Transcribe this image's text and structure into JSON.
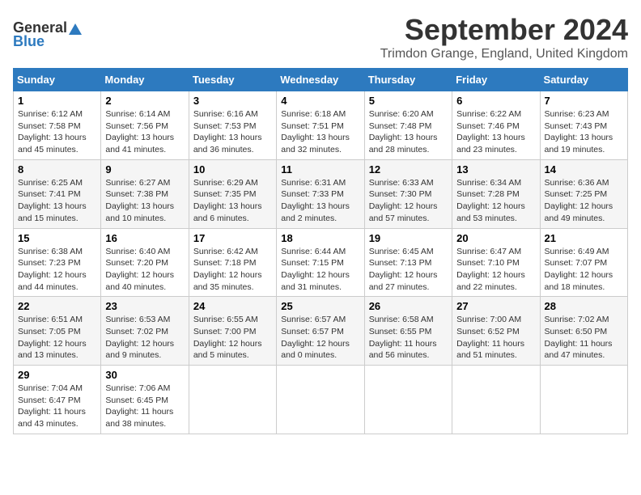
{
  "header": {
    "logo_general": "General",
    "logo_blue": "Blue",
    "month_title": "September 2024",
    "location": "Trimdon Grange, England, United Kingdom"
  },
  "weekdays": [
    "Sunday",
    "Monday",
    "Tuesday",
    "Wednesday",
    "Thursday",
    "Friday",
    "Saturday"
  ],
  "weeks": [
    [
      {
        "day": "1",
        "sunrise": "Sunrise: 6:12 AM",
        "sunset": "Sunset: 7:58 PM",
        "daylight": "Daylight: 13 hours and 45 minutes."
      },
      {
        "day": "2",
        "sunrise": "Sunrise: 6:14 AM",
        "sunset": "Sunset: 7:56 PM",
        "daylight": "Daylight: 13 hours and 41 minutes."
      },
      {
        "day": "3",
        "sunrise": "Sunrise: 6:16 AM",
        "sunset": "Sunset: 7:53 PM",
        "daylight": "Daylight: 13 hours and 36 minutes."
      },
      {
        "day": "4",
        "sunrise": "Sunrise: 6:18 AM",
        "sunset": "Sunset: 7:51 PM",
        "daylight": "Daylight: 13 hours and 32 minutes."
      },
      {
        "day": "5",
        "sunrise": "Sunrise: 6:20 AM",
        "sunset": "Sunset: 7:48 PM",
        "daylight": "Daylight: 13 hours and 28 minutes."
      },
      {
        "day": "6",
        "sunrise": "Sunrise: 6:22 AM",
        "sunset": "Sunset: 7:46 PM",
        "daylight": "Daylight: 13 hours and 23 minutes."
      },
      {
        "day": "7",
        "sunrise": "Sunrise: 6:23 AM",
        "sunset": "Sunset: 7:43 PM",
        "daylight": "Daylight: 13 hours and 19 minutes."
      }
    ],
    [
      {
        "day": "8",
        "sunrise": "Sunrise: 6:25 AM",
        "sunset": "Sunset: 7:41 PM",
        "daylight": "Daylight: 13 hours and 15 minutes."
      },
      {
        "day": "9",
        "sunrise": "Sunrise: 6:27 AM",
        "sunset": "Sunset: 7:38 PM",
        "daylight": "Daylight: 13 hours and 10 minutes."
      },
      {
        "day": "10",
        "sunrise": "Sunrise: 6:29 AM",
        "sunset": "Sunset: 7:35 PM",
        "daylight": "Daylight: 13 hours and 6 minutes."
      },
      {
        "day": "11",
        "sunrise": "Sunrise: 6:31 AM",
        "sunset": "Sunset: 7:33 PM",
        "daylight": "Daylight: 13 hours and 2 minutes."
      },
      {
        "day": "12",
        "sunrise": "Sunrise: 6:33 AM",
        "sunset": "Sunset: 7:30 PM",
        "daylight": "Daylight: 12 hours and 57 minutes."
      },
      {
        "day": "13",
        "sunrise": "Sunrise: 6:34 AM",
        "sunset": "Sunset: 7:28 PM",
        "daylight": "Daylight: 12 hours and 53 minutes."
      },
      {
        "day": "14",
        "sunrise": "Sunrise: 6:36 AM",
        "sunset": "Sunset: 7:25 PM",
        "daylight": "Daylight: 12 hours and 49 minutes."
      }
    ],
    [
      {
        "day": "15",
        "sunrise": "Sunrise: 6:38 AM",
        "sunset": "Sunset: 7:23 PM",
        "daylight": "Daylight: 12 hours and 44 minutes."
      },
      {
        "day": "16",
        "sunrise": "Sunrise: 6:40 AM",
        "sunset": "Sunset: 7:20 PM",
        "daylight": "Daylight: 12 hours and 40 minutes."
      },
      {
        "day": "17",
        "sunrise": "Sunrise: 6:42 AM",
        "sunset": "Sunset: 7:18 PM",
        "daylight": "Daylight: 12 hours and 35 minutes."
      },
      {
        "day": "18",
        "sunrise": "Sunrise: 6:44 AM",
        "sunset": "Sunset: 7:15 PM",
        "daylight": "Daylight: 12 hours and 31 minutes."
      },
      {
        "day": "19",
        "sunrise": "Sunrise: 6:45 AM",
        "sunset": "Sunset: 7:13 PM",
        "daylight": "Daylight: 12 hours and 27 minutes."
      },
      {
        "day": "20",
        "sunrise": "Sunrise: 6:47 AM",
        "sunset": "Sunset: 7:10 PM",
        "daylight": "Daylight: 12 hours and 22 minutes."
      },
      {
        "day": "21",
        "sunrise": "Sunrise: 6:49 AM",
        "sunset": "Sunset: 7:07 PM",
        "daylight": "Daylight: 12 hours and 18 minutes."
      }
    ],
    [
      {
        "day": "22",
        "sunrise": "Sunrise: 6:51 AM",
        "sunset": "Sunset: 7:05 PM",
        "daylight": "Daylight: 12 hours and 13 minutes."
      },
      {
        "day": "23",
        "sunrise": "Sunrise: 6:53 AM",
        "sunset": "Sunset: 7:02 PM",
        "daylight": "Daylight: 12 hours and 9 minutes."
      },
      {
        "day": "24",
        "sunrise": "Sunrise: 6:55 AM",
        "sunset": "Sunset: 7:00 PM",
        "daylight": "Daylight: 12 hours and 5 minutes."
      },
      {
        "day": "25",
        "sunrise": "Sunrise: 6:57 AM",
        "sunset": "Sunset: 6:57 PM",
        "daylight": "Daylight: 12 hours and 0 minutes."
      },
      {
        "day": "26",
        "sunrise": "Sunrise: 6:58 AM",
        "sunset": "Sunset: 6:55 PM",
        "daylight": "Daylight: 11 hours and 56 minutes."
      },
      {
        "day": "27",
        "sunrise": "Sunrise: 7:00 AM",
        "sunset": "Sunset: 6:52 PM",
        "daylight": "Daylight: 11 hours and 51 minutes."
      },
      {
        "day": "28",
        "sunrise": "Sunrise: 7:02 AM",
        "sunset": "Sunset: 6:50 PM",
        "daylight": "Daylight: 11 hours and 47 minutes."
      }
    ],
    [
      {
        "day": "29",
        "sunrise": "Sunrise: 7:04 AM",
        "sunset": "Sunset: 6:47 PM",
        "daylight": "Daylight: 11 hours and 43 minutes."
      },
      {
        "day": "30",
        "sunrise": "Sunrise: 7:06 AM",
        "sunset": "Sunset: 6:45 PM",
        "daylight": "Daylight: 11 hours and 38 minutes."
      },
      null,
      null,
      null,
      null,
      null
    ]
  ]
}
